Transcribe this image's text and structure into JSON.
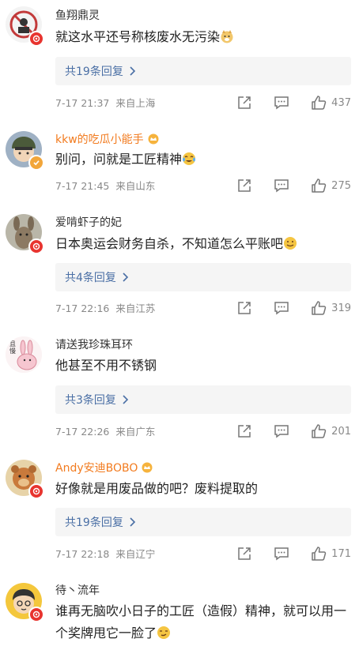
{
  "comments": [
    {
      "user": "鱼翔鼎灵",
      "text": "就这水平还号称核废水无污染",
      "emoji": "doge-emoji",
      "reply": "共19条回复",
      "time": "7-17 21:37",
      "loc": "来自上海",
      "likes": "437"
    },
    {
      "user": "kkw的吃瓜小能手",
      "text": "别问，问就是工匠精神",
      "emoji": "tears-of-joy-emoji",
      "time": "7-17 21:45",
      "loc": "来自山东",
      "likes": "275"
    },
    {
      "user": "爱啃虾子的妃",
      "text": "日本奥运会财务自杀，不知道怎么平账吧",
      "emoji": "grin-emoji",
      "reply": "共4条回复",
      "time": "7-17 22:16",
      "loc": "来自江苏",
      "likes": "319"
    },
    {
      "user": "请送我珍珠耳环",
      "avatar_text": "且\n慢",
      "text": "他甚至不用不锈钢",
      "reply": "共3条回复",
      "time": "7-17 22:26",
      "loc": "来自广东",
      "likes": "201"
    },
    {
      "user": "Andy安迪BOBO",
      "text": "好像就是用废品做的吧？废料提取的",
      "reply": "共19条回复",
      "time": "7-17 22:18",
      "loc": "来自辽宁",
      "likes": "171"
    },
    {
      "user": "待丶流年",
      "text": "谁再无脑吹小日子的工匠（造假）精神，就可以用一个奖牌甩它一脸了",
      "emoji": "sneer-emoji"
    }
  ],
  "colors": {
    "vip_name": "#f27b1f",
    "reply_link": "#4a6fa5",
    "meta": "#888888"
  }
}
